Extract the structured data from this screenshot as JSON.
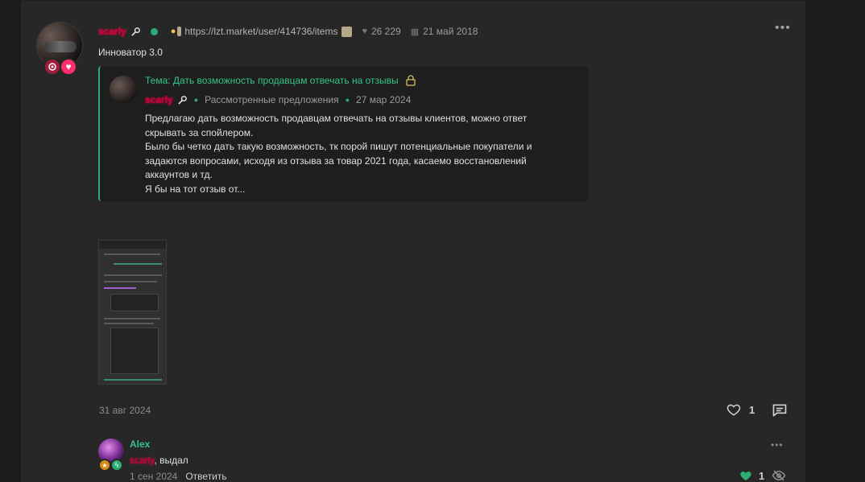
{
  "post": {
    "author": "scarly",
    "profile_link": "https://lzt.market/user/414736/items",
    "likes_total": "26 229",
    "register_date": "21 май 2018",
    "user_title": "Инноватор 3.0",
    "date": "31 авг 2024",
    "likes": "1"
  },
  "quote": {
    "title": "Тема: Дать возможность продавцам отвечать на отзывы",
    "author": "scarly",
    "section": "Рассмотренные предложения",
    "date": "27 мар 2024",
    "lines": [
      "Предлагаю дать возможность продавцам отвечать на отзывы клиентов, можно ответ",
      "скрывать за спойлером.",
      "Было бы четко дать такую возможность, тк порой пишут потенциальные покупатели и",
      "задаются вопросами, исходя из отзыва за товар 2021 года, касаемо восстановлений",
      "аккаунтов и тд.",
      "Я бы на тот отзыв от..."
    ]
  },
  "comment": {
    "author": "Alex",
    "mention": "scarly",
    "text": ", выдал",
    "date": "1 сен 2024",
    "reply_label": "Ответить",
    "likes": "1"
  },
  "colors": {
    "accent_green": "#2bad72",
    "username_red": "#c8003c",
    "background": "#272727"
  }
}
